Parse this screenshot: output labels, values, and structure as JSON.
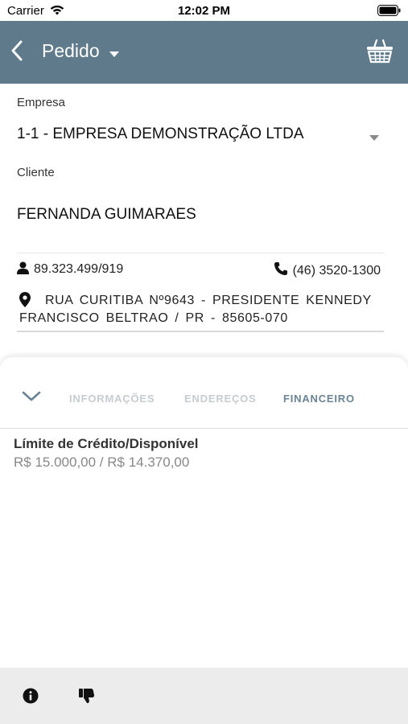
{
  "status_bar": {
    "carrier": "Carrier",
    "time": "12:02 PM"
  },
  "app_bar": {
    "title": "Pedido",
    "bg_color": "#5f7b8b"
  },
  "form": {
    "empresa_label": "Empresa",
    "empresa_value": "1-1 - EMPRESA DEMONSTRAÇÃO LTDA",
    "cliente_label": "Cliente",
    "cliente_value": "FERNANDA GUIMARAES",
    "document": "89.323.499/919",
    "phone": "(46) 3520-1300",
    "address_line1": "RUA CURITIBA Nº9643 - PRESIDENTE KENNEDY",
    "address_line2": "FRANCISCO BELTRAO / PR - 85605-070"
  },
  "sheet": {
    "tabs": [
      {
        "label": "INFORMAÇÕES",
        "active": false
      },
      {
        "label": "ENDEREÇOS",
        "active": false
      },
      {
        "label": "FINANCEIRO",
        "active": true
      }
    ],
    "credit_label": "Límite de Crédito/Disponível",
    "credit_value": "R$ 15.000,00 / R$ 14.370,00"
  },
  "icons": {
    "back": "chevron-left-icon",
    "title_caret": "caret-down-icon",
    "basket": "basket-icon",
    "dropdown": "caret-down-icon",
    "person": "person-icon",
    "phone": "phone-icon",
    "location": "location-pin-icon",
    "collapse": "chevron-down-icon",
    "info": "info-icon",
    "dislike": "thumbs-down-icon"
  }
}
